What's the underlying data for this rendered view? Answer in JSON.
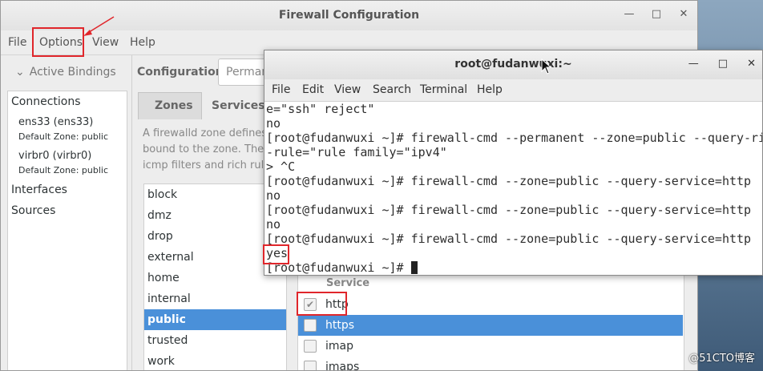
{
  "firewall": {
    "title": "Firewall Configuration",
    "menu": [
      "File",
      "Options",
      "View",
      "Help"
    ],
    "active_bindings": "Active Bindings",
    "connections_label": "Connections",
    "connections": [
      {
        "name": "ens33 (ens33)",
        "zone": "Default Zone: public"
      },
      {
        "name": "virbr0 (virbr0)",
        "zone": "Default Zone: public"
      }
    ],
    "interfaces_label": "Interfaces",
    "sources_label": "Sources",
    "configuration_label": "Configuration:",
    "configuration_value": "Perman",
    "tabs": [
      "Zones",
      "Services"
    ],
    "description": [
      "A firewalld zone defines",
      "bound to the zone. The",
      "icmp filters and rich rule"
    ],
    "zones": [
      "block",
      "dmz",
      "drop",
      "external",
      "home",
      "internal",
      "public",
      "trusted",
      "work"
    ],
    "selected_zone": "public",
    "service_header": "Service",
    "services": [
      {
        "name": "http",
        "checked": true
      },
      {
        "name": "https",
        "checked": false
      },
      {
        "name": "imap",
        "checked": false
      },
      {
        "name": "imaps",
        "checked": false
      }
    ]
  },
  "terminal": {
    "title": "root@fudanwuxi:~",
    "menu": [
      "File",
      "Edit",
      "View",
      "Search",
      "Terminal",
      "Help"
    ],
    "lines": [
      "e=\"ssh\" reject\"",
      "no",
      "[root@fudanwuxi ~]# firewall-cmd --permanent --zone=public --query-ri",
      "-rule=\"rule family=\"ipv4\"",
      "> ^C",
      "[root@fudanwuxi ~]# firewall-cmd --zone=public --query-service=http",
      "no",
      "[root@fudanwuxi ~]# firewall-cmd --zone=public --query-service=http",
      "no",
      "[root@fudanwuxi ~]# firewall-cmd --zone=public --query-service=http",
      "yes",
      "[root@fudanwuxi ~]# "
    ]
  },
  "watermark": "@51CTO博客",
  "colors": {
    "selection": "#4a90d9",
    "highlight": "#e0262b"
  }
}
